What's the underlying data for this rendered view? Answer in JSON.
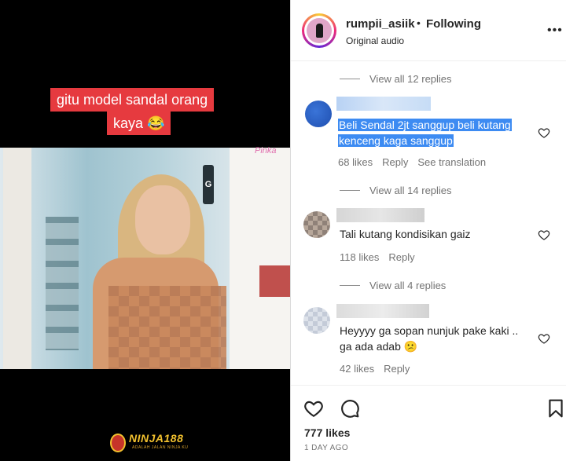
{
  "video": {
    "caption_line1": "gitu model sandal orang",
    "caption_line2": "kaya 😂",
    "wall_label": "G",
    "watermark_text": "Pinka",
    "brand_name": "NINJA188",
    "brand_tagline": "ADALAH JALAN NINJA KU"
  },
  "post": {
    "username": "rumpii_asiik",
    "separator": "•",
    "follow_status": "Following",
    "audio": "Original audio",
    "more": "•••"
  },
  "comments": {
    "view_replies_top": "View all 12 replies",
    "items": [
      {
        "text_line1": "Beli Sendal 2jt sanggup beli kutang",
        "text_line2": "kenceng kaga sanggup",
        "likes": "68 likes",
        "reply": "Reply",
        "translate": "See translation",
        "view_replies": "View all 14 replies"
      },
      {
        "text": "Tali kutang kondisikan gaiz",
        "likes": "118 likes",
        "reply": "Reply",
        "view_replies": "View all 4 replies"
      },
      {
        "text_line1": "Heyyyy ga sopan nunjuk pake kaki ..",
        "text_line2": "ga ada adab 😕",
        "likes": "42 likes",
        "reply": "Reply"
      }
    ]
  },
  "footer": {
    "likes": "777 likes",
    "date": "1 DAY AGO"
  },
  "colors": {
    "selection": "#3d8bf2",
    "caption_bg": "#e63a3f",
    "muted": "#737373"
  }
}
